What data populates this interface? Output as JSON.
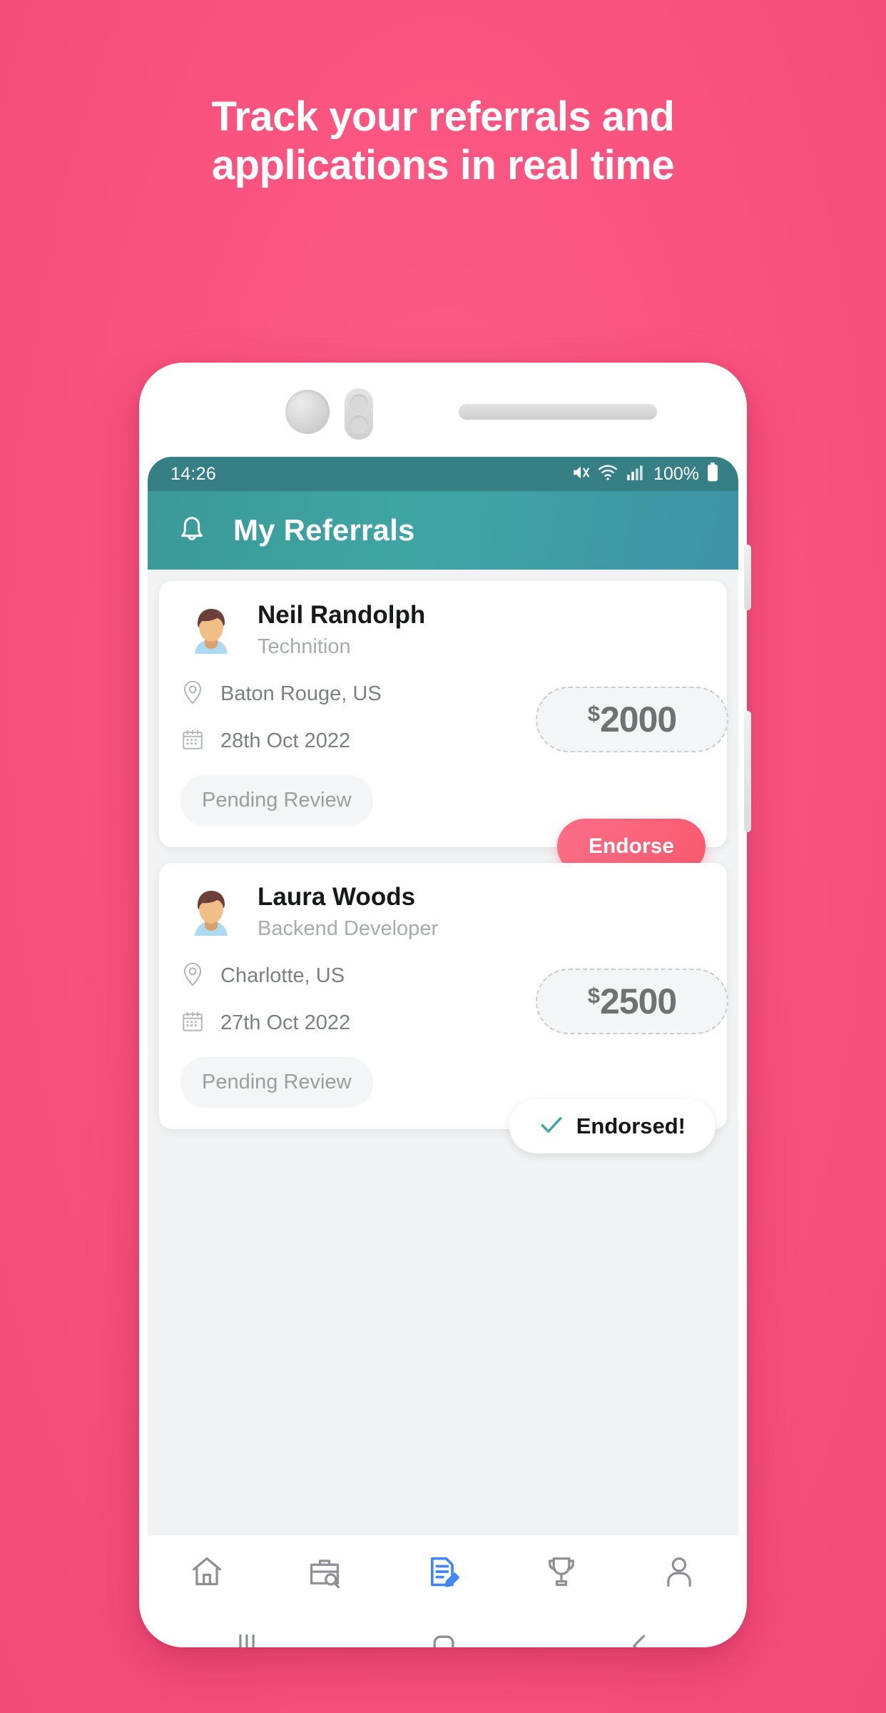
{
  "promo": {
    "line1": "Track your referrals and",
    "line2": "applications in real time",
    "bg_color": "#f9527e"
  },
  "statusbar": {
    "time": "14:26",
    "battery_percent": "100%",
    "icons": [
      "mute-icon",
      "wifi-icon",
      "signal-icon",
      "battery-icon"
    ],
    "bg_color": "#367f85"
  },
  "appbar": {
    "title": "My Referrals",
    "bell_icon": "bell-icon",
    "bg_color": "#3fa5a3"
  },
  "referrals": [
    {
      "name": "Neil Randolph",
      "role": "Technition",
      "location": "Baton Rouge, US",
      "date": "28th Oct 2022",
      "currency": "$",
      "amount": "2000",
      "status": "Pending Review",
      "action_label": "Endorse",
      "action_state": "pending"
    },
    {
      "name": "Laura Woods",
      "role": "Backend Developer",
      "location": "Charlotte, US",
      "date": "27th Oct 2022",
      "currency": "$",
      "amount": "2500",
      "status": "Pending Review",
      "action_label": "Endorsed!",
      "action_state": "endorsed"
    }
  ],
  "bottom_nav": {
    "active_index": 2,
    "active_color": "#4285f4",
    "inactive_color": "#8d9094",
    "items": [
      {
        "icon": "home-icon",
        "label": "Home"
      },
      {
        "icon": "briefcase-search-icon",
        "label": "Jobs"
      },
      {
        "icon": "document-edit-icon",
        "label": "Referrals"
      },
      {
        "icon": "trophy-icon",
        "label": "Rewards"
      },
      {
        "icon": "person-icon",
        "label": "Profile"
      }
    ]
  },
  "system_nav": {
    "items": [
      {
        "icon": "recents-icon",
        "label": "Recents"
      },
      {
        "icon": "home-square-icon",
        "label": "Home"
      },
      {
        "icon": "back-chevron-icon",
        "label": "Back"
      }
    ]
  }
}
